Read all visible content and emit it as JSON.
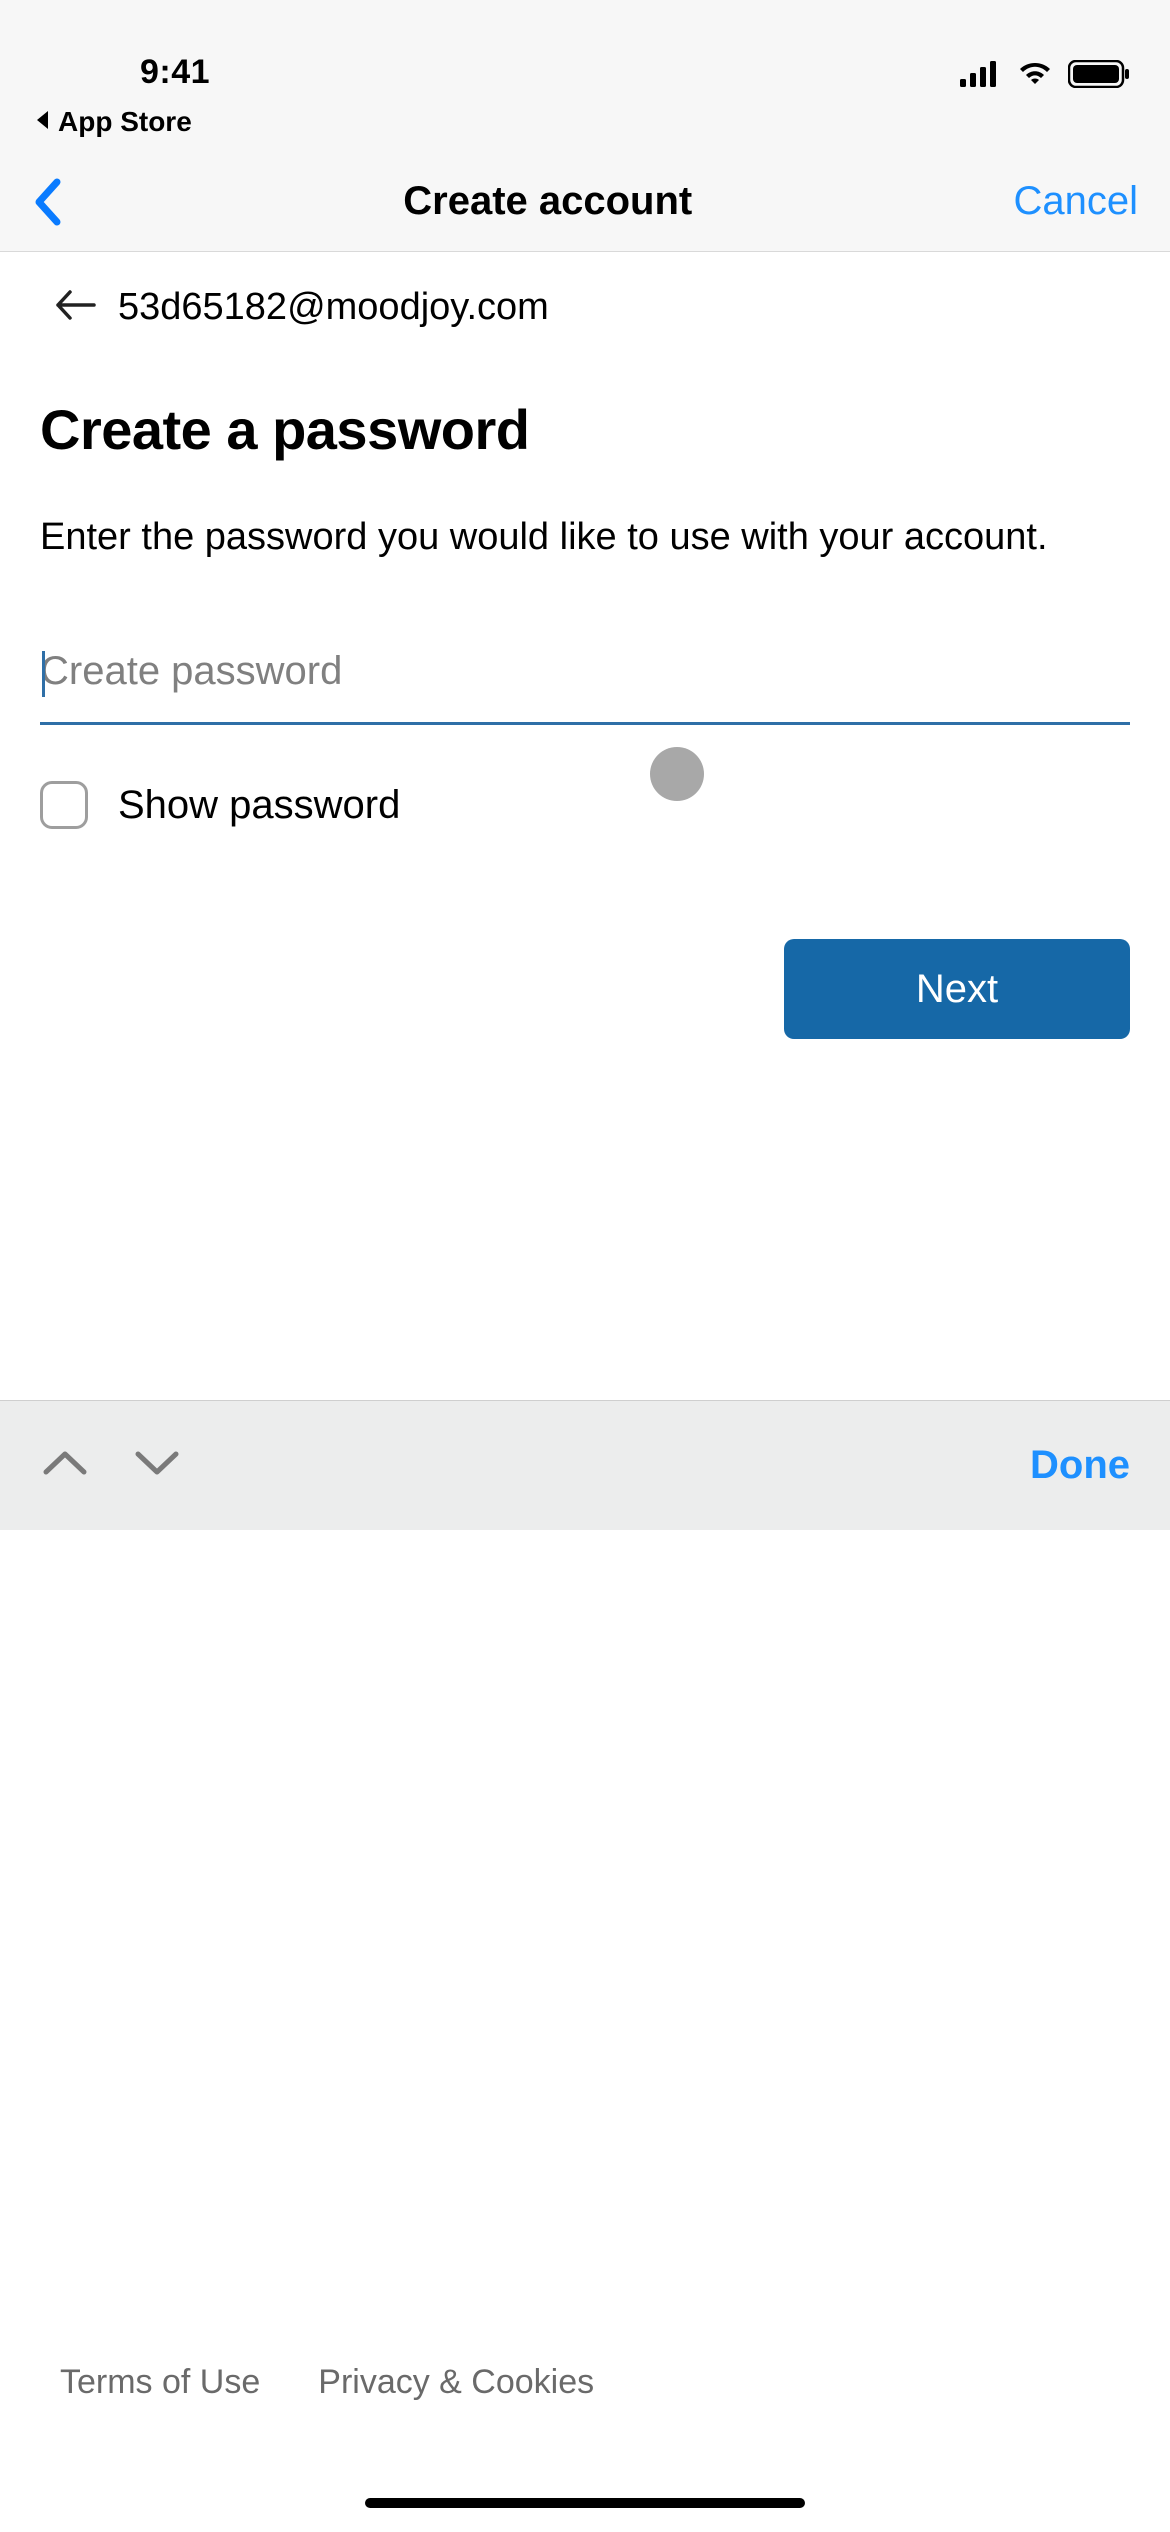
{
  "status": {
    "time": "9:41",
    "breadcrumb": "App Store"
  },
  "nav": {
    "title": "Create account",
    "cancel": "Cancel"
  },
  "page": {
    "email": "53d65182@moodjoy.com",
    "heading": "Create a password",
    "subtext": "Enter the password you would like to use with your account.",
    "password_placeholder": "Create password",
    "show_password_label": "Show password",
    "next_label": "Next"
  },
  "accessory": {
    "done": "Done"
  },
  "footer": {
    "terms": "Terms of Use",
    "privacy": "Privacy & Cookies"
  },
  "colors": {
    "accent_blue": "#1e90ff",
    "button_blue": "#1668a7",
    "underline_blue": "#2f6fa7"
  }
}
